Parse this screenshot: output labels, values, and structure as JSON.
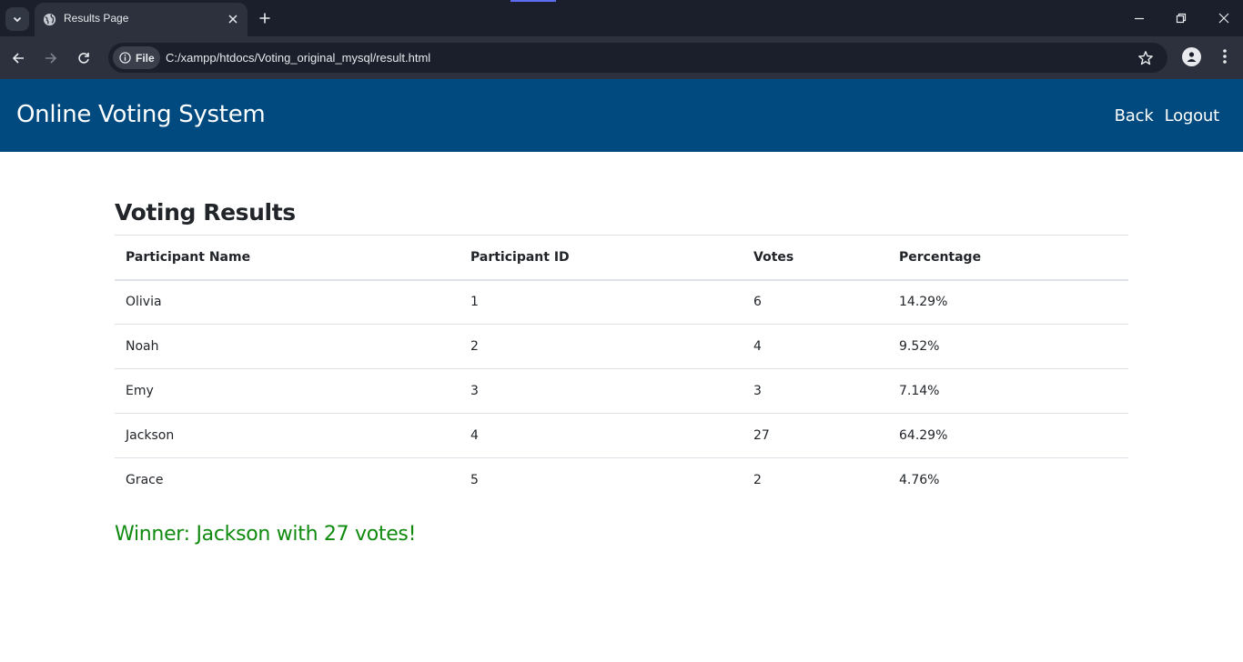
{
  "browser": {
    "tab_title": "Results Page",
    "site_chip_label": "File",
    "url": "C:/xampp/htdocs/Voting_original_mysql/result.html"
  },
  "header": {
    "site_title": "Online Voting System",
    "nav": {
      "back": "Back",
      "logout": "Logout"
    }
  },
  "results": {
    "heading": "Voting Results",
    "columns": {
      "name": "Participant Name",
      "id": "Participant ID",
      "votes": "Votes",
      "percentage": "Percentage"
    },
    "rows": [
      {
        "name": "Olivia",
        "id": "1",
        "votes": "6",
        "percentage": "14.29%"
      },
      {
        "name": "Noah",
        "id": "2",
        "votes": "4",
        "percentage": "9.52%"
      },
      {
        "name": "Emy",
        "id": "3",
        "votes": "3",
        "percentage": "7.14%"
      },
      {
        "name": "Jackson",
        "id": "4",
        "votes": "27",
        "percentage": "64.29%"
      },
      {
        "name": "Grace",
        "id": "5",
        "votes": "2",
        "percentage": "4.76%"
      }
    ],
    "winner_text": "Winner: Jackson with 27 votes!"
  },
  "colors": {
    "header_bg": "#004a7f",
    "winner_text": "#0f8a0f"
  }
}
